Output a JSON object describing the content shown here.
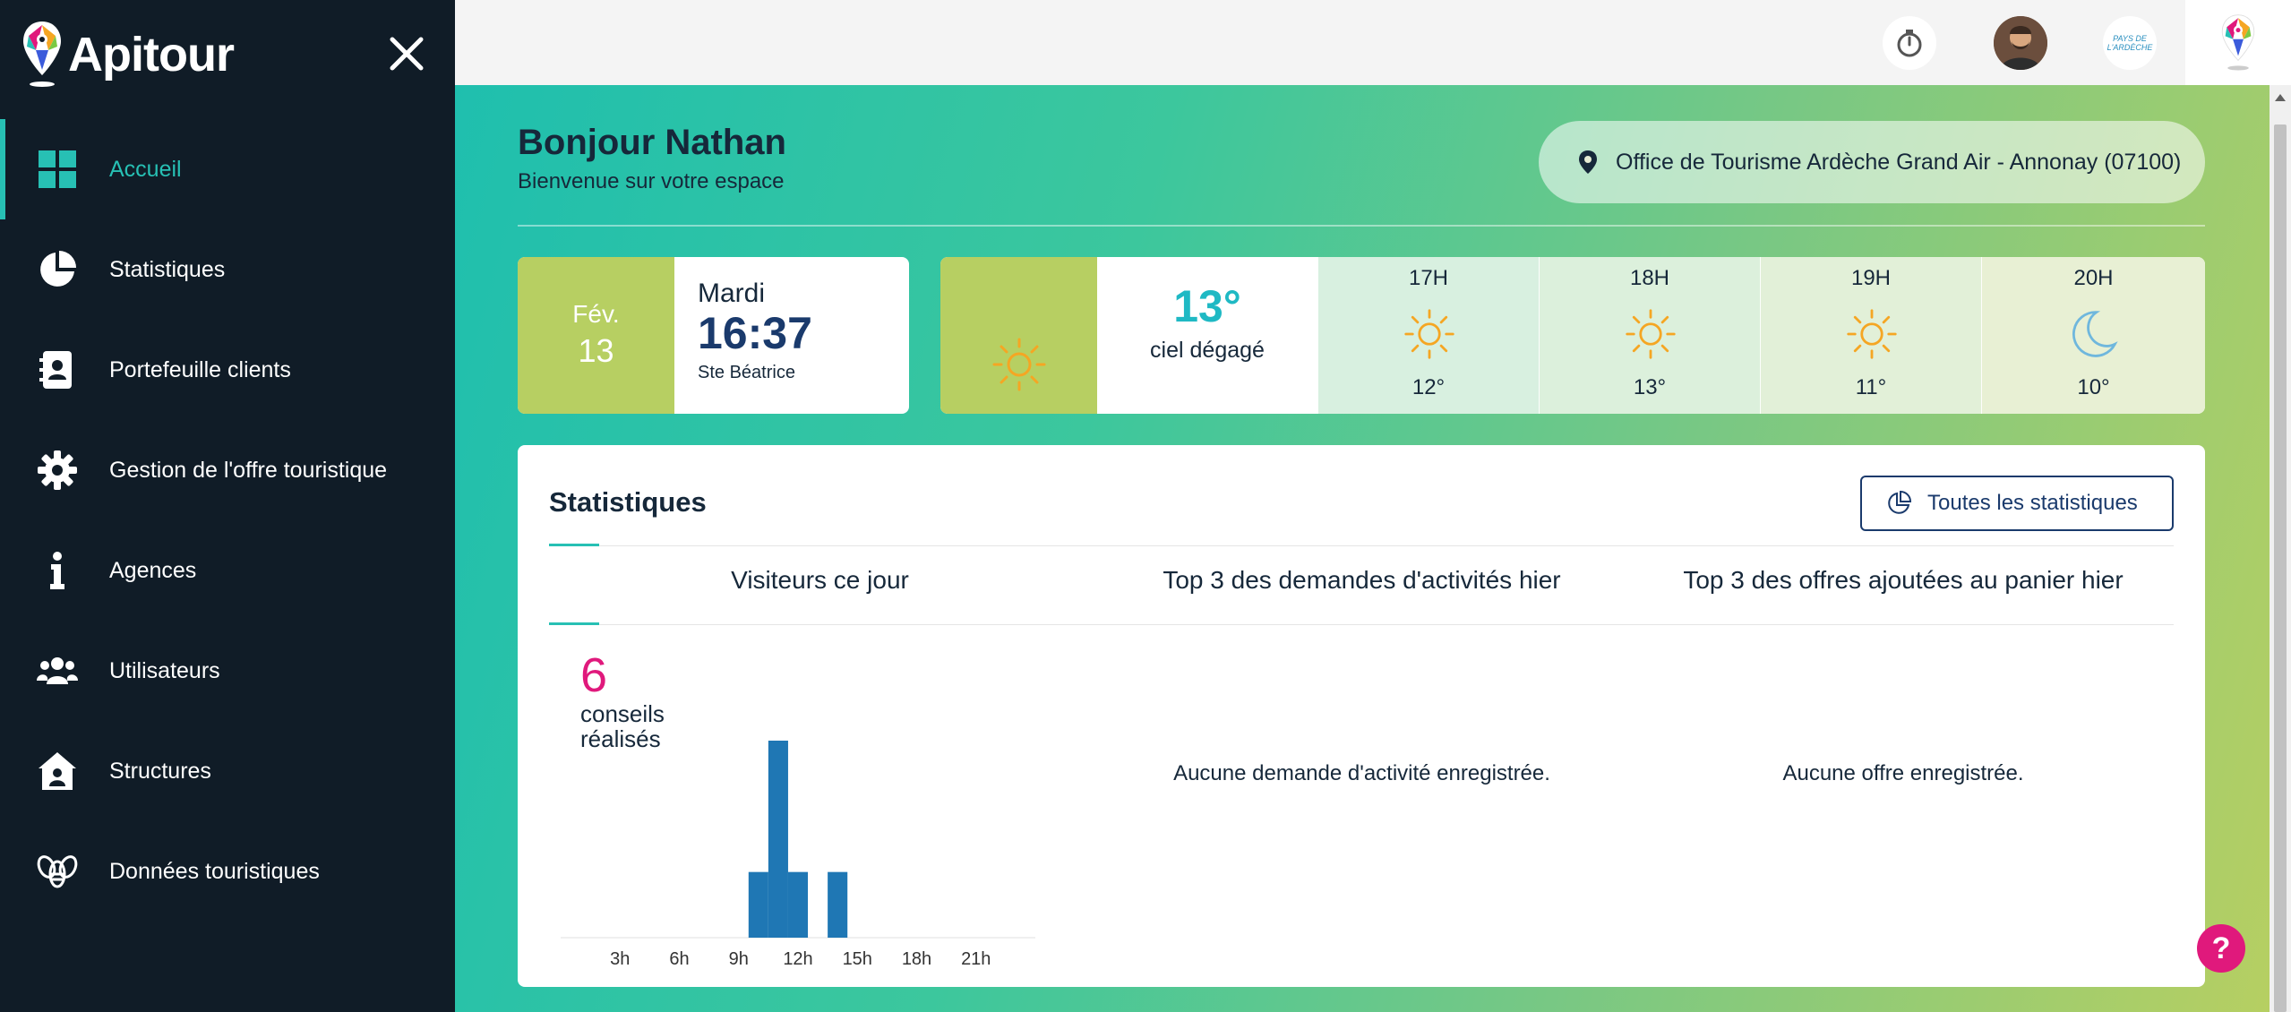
{
  "app": {
    "name": "Apitour"
  },
  "sidebar": {
    "items": [
      {
        "label": "Accueil",
        "icon": "dashboard-icon",
        "active": true
      },
      {
        "label": "Statistiques",
        "icon": "pie-chart-icon"
      },
      {
        "label": "Portefeuille clients",
        "icon": "contact-book-icon"
      },
      {
        "label": "Gestion de l'offre touristique",
        "icon": "gear-icon"
      },
      {
        "label": "Agences",
        "icon": "info-icon"
      },
      {
        "label": "Utilisateurs",
        "icon": "users-icon"
      },
      {
        "label": "Structures",
        "icon": "house-user-icon"
      },
      {
        "label": "Données touristiques",
        "icon": "bee-icon"
      }
    ]
  },
  "topbar": {
    "org_logo_text": "PAYS DE L'ARDÈCHE"
  },
  "greeting": {
    "title": "Bonjour Nathan",
    "subtitle": "Bienvenue sur votre espace"
  },
  "location": {
    "label": "Office de Tourisme Ardèche Grand Air - Annonay (07100)"
  },
  "date_card": {
    "month": "Fév.",
    "day": "13",
    "weekday": "Mardi",
    "time": "16:37",
    "saint": "Ste Béatrice"
  },
  "weather": {
    "current_temp": "13°",
    "current_desc": "ciel dégagé",
    "forecast": [
      {
        "hour": "17H",
        "temp": "12°",
        "icon": "sun-icon"
      },
      {
        "hour": "18H",
        "temp": "13°",
        "icon": "sun-icon"
      },
      {
        "hour": "19H",
        "temp": "11°",
        "icon": "sun-icon"
      },
      {
        "hour": "20H",
        "temp": "10°",
        "icon": "moon-icon"
      }
    ]
  },
  "stats": {
    "title": "Statistiques",
    "button_label": "Toutes les statistiques",
    "columns": [
      "Visiteurs ce jour",
      "Top 3 des demandes d'activités hier",
      "Top 3 des offres ajoutées au panier hier"
    ],
    "visitors_count": "6",
    "visitors_caption": "conseils réalisés",
    "empty_activities": "Aucune demande d'activité enregistrée.",
    "empty_offers": "Aucune offre enregistrée."
  },
  "colors": {
    "sidebar_bg": "#101c27",
    "accent": "#27c0b4",
    "brand_pink": "#e0197c",
    "navy": "#1a3a6c",
    "bar_blue": "#1f77b4",
    "lime": "#b7cf62"
  },
  "chart_data": {
    "type": "bar",
    "x_tick_labels": [
      "3h",
      "6h",
      "9h",
      "12h",
      "15h",
      "18h",
      "21h"
    ],
    "x_ticks": [
      3,
      6,
      9,
      12,
      15,
      18,
      21
    ],
    "xlim": [
      0,
      24
    ],
    "ylim": [
      0,
      3
    ],
    "bars": [
      {
        "hour": 10,
        "value": 1
      },
      {
        "hour": 11,
        "value": 3
      },
      {
        "hour": 12,
        "value": 1
      },
      {
        "hour": 14,
        "value": 1
      }
    ],
    "grid": false
  }
}
